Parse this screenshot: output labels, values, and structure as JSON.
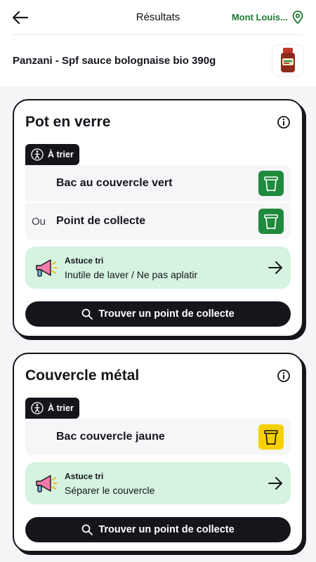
{
  "header": {
    "title": "Résultats",
    "location": "Mont Louis..."
  },
  "product": {
    "name": "Panzani - Spf sauce bolognaise bio 390g"
  },
  "cards": [
    {
      "title": "Pot en verre",
      "tag": "À trier",
      "bins": [
        {
          "prefix": "",
          "label": "Bac au couvercle vert",
          "color": "#1f8a3c"
        },
        {
          "prefix": "Ou",
          "label": "Point de collecte",
          "color": "#1f8a3c"
        }
      ],
      "tip": {
        "title": "Astuce tri",
        "text": "Inutile de laver / Ne pas aplatir"
      },
      "button": "Trouver un point de collecte"
    },
    {
      "title": "Couvercle métal",
      "tag": "À trier",
      "bins": [
        {
          "prefix": "",
          "label": "Bac couvercle jaune",
          "color": "#f5d000"
        }
      ],
      "tip": {
        "title": "Astuce tri",
        "text": "Séparer le couvercle"
      },
      "button": "Trouver un point de collecte"
    }
  ],
  "colors": {
    "accent_green": "#1d7a32",
    "dark": "#14161c",
    "tip_bg": "#d5f3df"
  }
}
